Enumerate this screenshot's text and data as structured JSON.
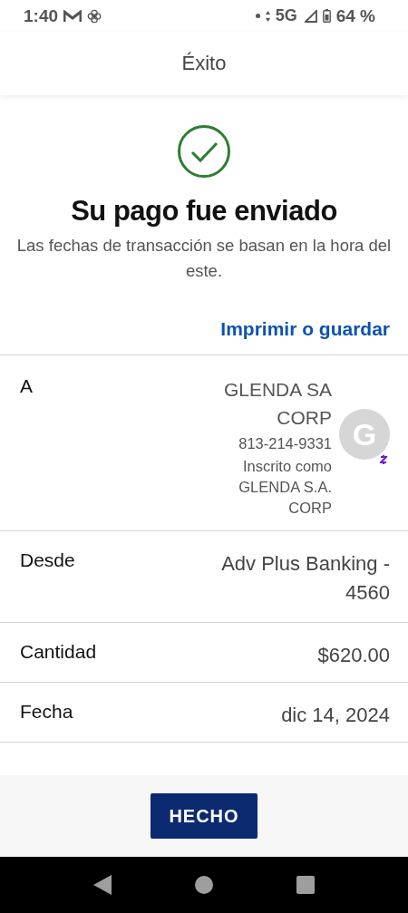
{
  "status_bar": {
    "time": "1:40",
    "network": "5G",
    "battery": "64 %"
  },
  "header": {
    "title": "Éxito"
  },
  "success": {
    "heading": "Su pago fue enviado",
    "note": "Las fechas de transacción se basan en la hora del este.",
    "print_link": "Imprimir o guardar"
  },
  "details": [
    {
      "kind": "recipient",
      "label": "A",
      "name": "GLENDA SA CORP",
      "phone": "813-214-9331",
      "enrolled": "Inscrito como GLENDA S.A. CORP",
      "avatar": "G"
    },
    {
      "kind": "text",
      "label": "Desde",
      "value": "Adv Plus Banking - 4560"
    },
    {
      "kind": "text",
      "label": "Cantidad",
      "value": "$620.00"
    },
    {
      "kind": "text",
      "label": "Fecha",
      "value": "dic 14, 2024"
    }
  ],
  "done_button": "HECHO"
}
